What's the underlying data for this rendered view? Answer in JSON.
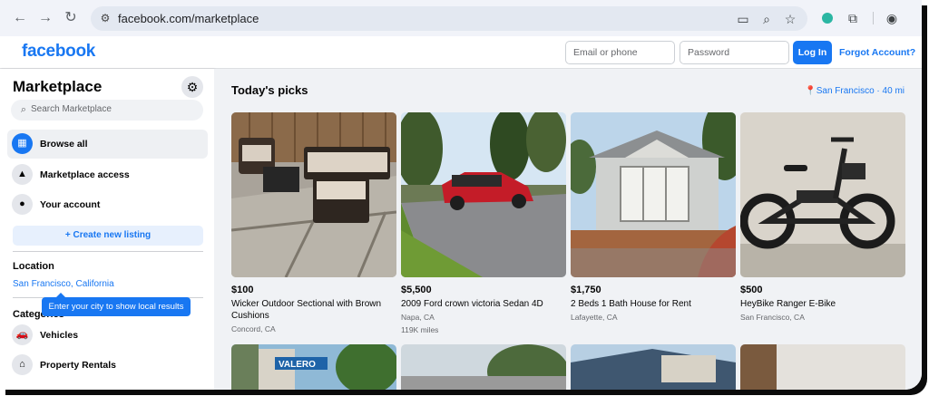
{
  "browser": {
    "url": "facebook.com/marketplace"
  },
  "header": {
    "logo": "facebook",
    "email_placeholder": "Email or phone",
    "password_placeholder": "Password",
    "login_label": "Log In",
    "forgot_label": "Forgot Account?"
  },
  "sidebar": {
    "title": "Marketplace",
    "search_placeholder": "Search Marketplace",
    "items": [
      {
        "label": "Browse all",
        "icon": "storefront-icon"
      },
      {
        "label": "Marketplace access",
        "icon": "warning-icon"
      },
      {
        "label": "Your account",
        "icon": "person-icon"
      }
    ],
    "create_label": "+ Create new listing",
    "location_heading": "Location",
    "location_value": "San Francisco, California",
    "tooltip": "Enter your city to show local results",
    "categories_heading": "Categories",
    "categories": [
      {
        "label": "Vehicles",
        "icon": "car-icon"
      },
      {
        "label": "Property Rentals",
        "icon": "house-icon"
      }
    ]
  },
  "main": {
    "heading": "Today's picks",
    "location_label": "San Francisco · 40 mi",
    "listings": [
      {
        "price": "$100",
        "title": "Wicker Outdoor Sectional with Brown Cushions",
        "location": "Concord, CA",
        "extra": ""
      },
      {
        "price": "$5,500",
        "title": "2009 Ford crown victoria Sedan 4D",
        "location": "Napa, CA",
        "extra": "119K miles"
      },
      {
        "price": "$1,750",
        "title": "2 Beds 1 Bath House for Rent",
        "location": "Lafayette, CA",
        "extra": ""
      },
      {
        "price": "$500",
        "title": "HeyBike Ranger E-Bike",
        "location": "San Francisco, CA",
        "extra": ""
      }
    ],
    "second_row_sign": "VALERO"
  },
  "colors": {
    "brand": "#1877f2",
    "background": "#f0f2f5"
  }
}
